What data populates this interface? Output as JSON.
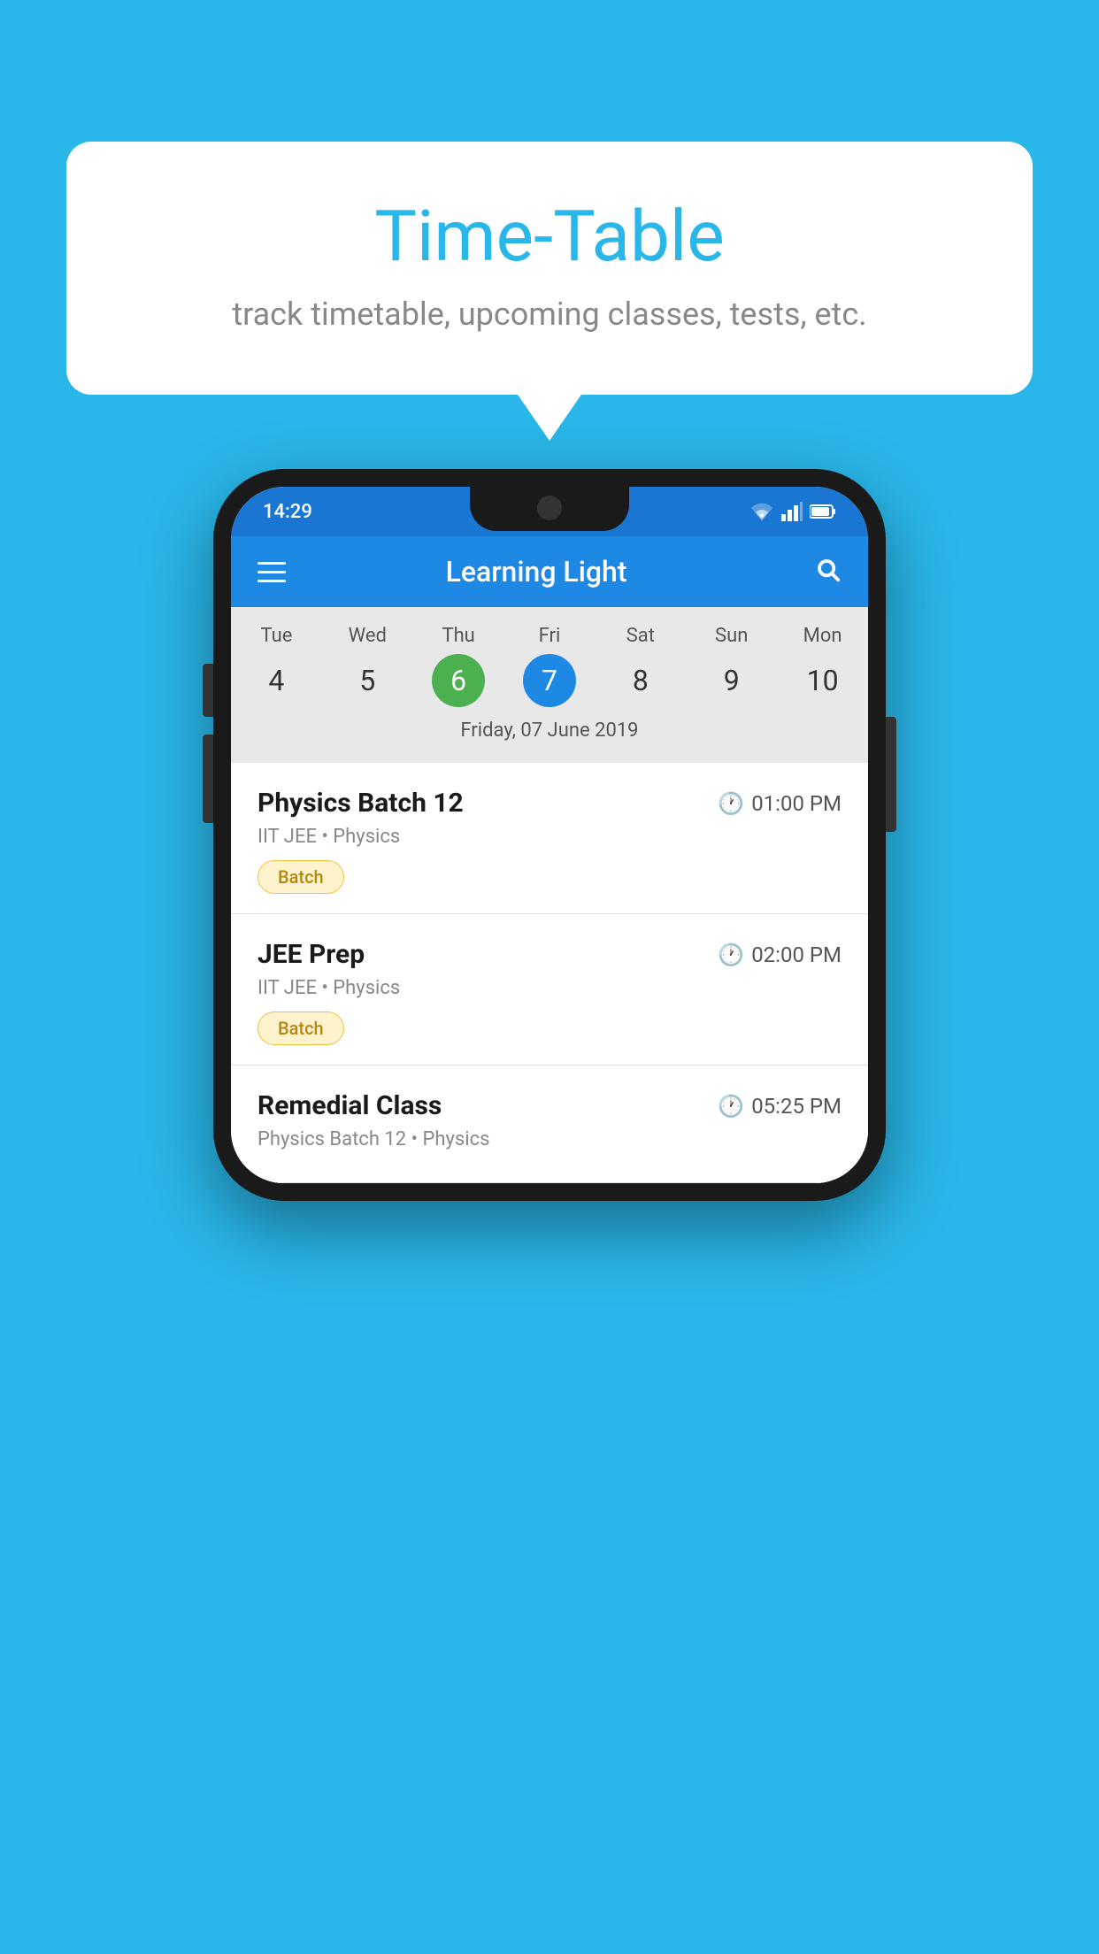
{
  "background_color": "#29B6E8",
  "speech_bubble": {
    "title": "Time-Table",
    "subtitle": "track timetable, upcoming classes, tests, etc."
  },
  "phone": {
    "status_bar": {
      "time": "14:29",
      "color": "#1976D2"
    },
    "app_bar": {
      "title": "Learning Light",
      "color": "#1E88E5"
    },
    "calendar": {
      "days": [
        {
          "abbr": "Tue",
          "num": "4"
        },
        {
          "abbr": "Wed",
          "num": "5"
        },
        {
          "abbr": "Thu",
          "num": "6",
          "state": "today"
        },
        {
          "abbr": "Fri",
          "num": "7",
          "state": "selected"
        },
        {
          "abbr": "Sat",
          "num": "8"
        },
        {
          "abbr": "Sun",
          "num": "9"
        },
        {
          "abbr": "Mon",
          "num": "10"
        }
      ],
      "selected_date_label": "Friday, 07 June 2019"
    },
    "schedule": [
      {
        "title": "Physics Batch 12",
        "time": "01:00 PM",
        "subtitle": "IIT JEE • Physics",
        "tag": "Batch"
      },
      {
        "title": "JEE Prep",
        "time": "02:00 PM",
        "subtitle": "IIT JEE • Physics",
        "tag": "Batch"
      },
      {
        "title": "Remedial Class",
        "time": "05:25 PM",
        "subtitle": "Physics Batch 12 • Physics",
        "tag": null
      }
    ]
  }
}
